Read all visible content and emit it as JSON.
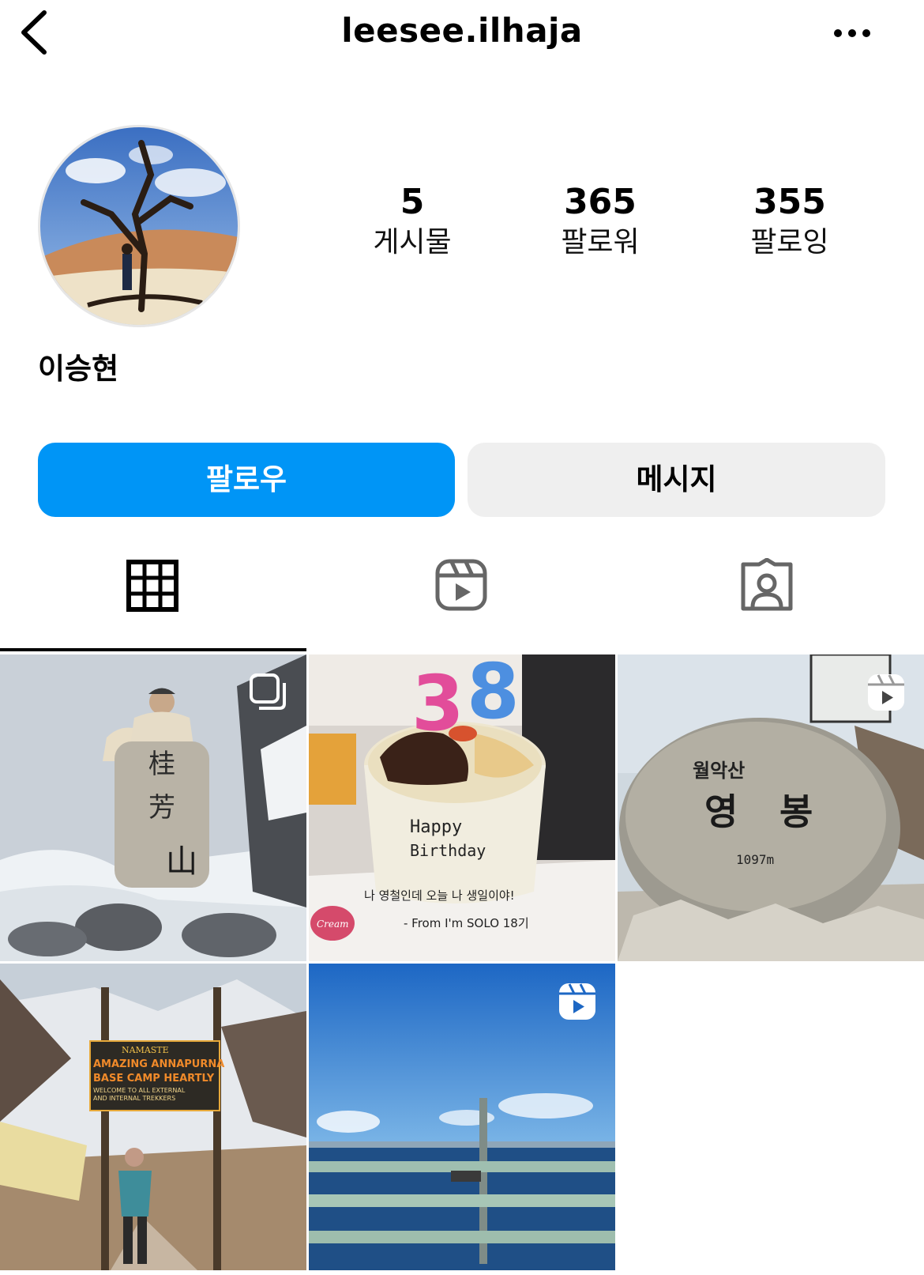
{
  "header": {
    "title": "leesee.ilhaja",
    "back_icon": "chevron-left-icon",
    "more_icon": "more-horizontal-icon"
  },
  "profile": {
    "display_name": "이승현",
    "stats": {
      "posts": {
        "value": "5",
        "label": "게시물"
      },
      "followers": {
        "value": "365",
        "label": "팔로워"
      },
      "following": {
        "value": "355",
        "label": "팔로잉"
      }
    }
  },
  "actions": {
    "follow_label": "팔로우",
    "message_label": "메시지"
  },
  "tabs": [
    {
      "icon": "grid-icon",
      "selected": true
    },
    {
      "icon": "reels-icon",
      "selected": false
    },
    {
      "icon": "tagged-icon",
      "selected": false
    }
  ],
  "posts": [
    {
      "subject": "snowy mountain summit stone",
      "badge": "carousel-icon"
    },
    {
      "subject": "birthday cake with 38 candles",
      "badge": ""
    },
    {
      "subject": "summit stone with carved letters",
      "badge": "reels-icon"
    },
    {
      "subject": "annapurna base camp sign",
      "badge": ""
    },
    {
      "subject": "sea view from a bridge",
      "badge": "reels-icon"
    }
  ],
  "colors": {
    "accent": "#0095f6",
    "secondary_button": "#efefef"
  }
}
